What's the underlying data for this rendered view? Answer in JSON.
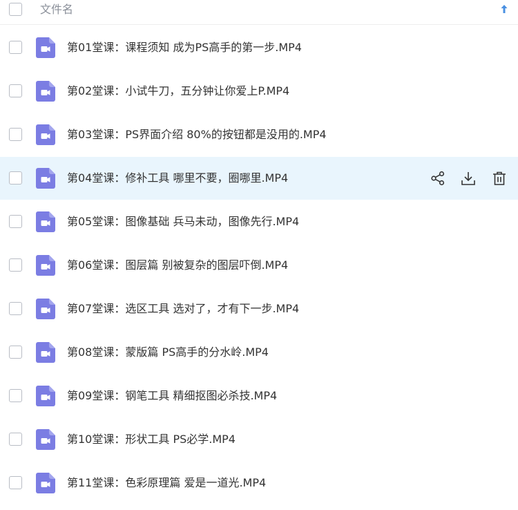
{
  "header": {
    "column_label": "文件名",
    "sort_icon": "arrow-up-icon"
  },
  "file_icon": "video-file-icon",
  "accent_color": "#7b7de3",
  "hover_background": "#e9f5fd",
  "files": [
    {
      "name": "第01堂课：课程须知 成为PS高手的第一步.MP4"
    },
    {
      "name": "第02堂课：小试牛刀，五分钟让你爱上P.MP4"
    },
    {
      "name": "第03堂课：PS界面介绍  80%的按钮都是没用的.MP4"
    },
    {
      "name": "第04堂课：修补工具  哪里不要，圈哪里.MP4",
      "hovered": true
    },
    {
      "name": "第05堂课：图像基础  兵马未动，图像先行.MP4"
    },
    {
      "name": "第06堂课：图层篇  别被复杂的图层吓倒.MP4"
    },
    {
      "name": "第07堂课：选区工具  选对了，才有下一步.MP4"
    },
    {
      "name": "第08堂课：蒙版篇  PS高手的分水岭.MP4"
    },
    {
      "name": "第09堂课：钢笔工具  精细抠图必杀技.MP4"
    },
    {
      "name": "第10堂课：形状工具  PS必学.MP4"
    },
    {
      "name": "第11堂课：色彩原理篇  爱是一道光.MP4"
    }
  ],
  "row_actions": [
    "share-icon",
    "download-icon",
    "trash-icon"
  ]
}
